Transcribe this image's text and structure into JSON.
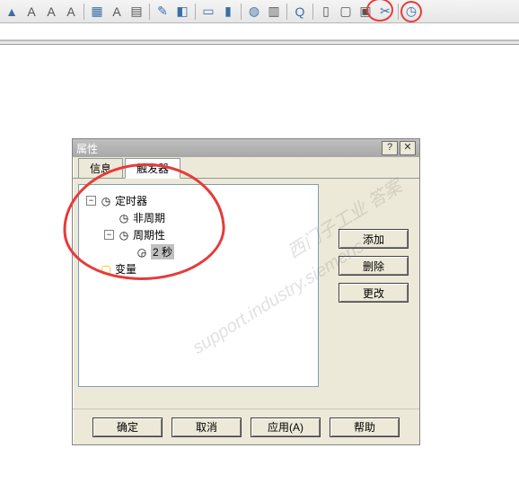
{
  "toolbar": {
    "buttons": [
      {
        "name": "pointer-icon",
        "glyph": "▲",
        "cls": "blue"
      },
      {
        "name": "text-a-icon",
        "glyph": "A"
      },
      {
        "name": "a-slash-icon",
        "glyph": "A"
      },
      {
        "name": "a-italic-icon",
        "glyph": "A"
      },
      {
        "sep": true
      },
      {
        "name": "palette-icon",
        "glyph": "▦",
        "cls": "blue"
      },
      {
        "name": "font-color-icon",
        "glyph": "A"
      },
      {
        "name": "brush-icon",
        "glyph": "▤"
      },
      {
        "sep": true
      },
      {
        "name": "wrench-icon",
        "glyph": "✎",
        "cls": "blue"
      },
      {
        "name": "window-icon",
        "glyph": "◧",
        "cls": "blue"
      },
      {
        "sep": true
      },
      {
        "name": "panel-icon",
        "glyph": "▭",
        "cls": "blue"
      },
      {
        "name": "fill-icon",
        "glyph": "▮",
        "cls": "blue"
      },
      {
        "sep": true
      },
      {
        "name": "globe-icon",
        "glyph": "◍",
        "cls": "blue"
      },
      {
        "name": "chart-icon",
        "glyph": "▥"
      },
      {
        "sep": true
      },
      {
        "name": "search-icon",
        "glyph": "Q",
        "cls": "blue"
      },
      {
        "sep": true
      },
      {
        "name": "folder-icon",
        "glyph": "▯"
      },
      {
        "name": "archive-icon",
        "glyph": "▢"
      },
      {
        "name": "package-icon",
        "glyph": "▣"
      },
      {
        "name": "scissors-icon",
        "glyph": "✂",
        "cls": "blue"
      },
      {
        "sep": true
      },
      {
        "name": "clock-icon",
        "glyph": "◷",
        "cls": "blue",
        "circled": true
      }
    ]
  },
  "dialog": {
    "title": "属性",
    "help_label": "?",
    "close_label": "✕",
    "tabs": [
      {
        "id": "info",
        "label": "信息"
      },
      {
        "id": "trigger",
        "label": "触发器",
        "active": true
      }
    ],
    "tree": {
      "timer": {
        "label": "定时器",
        "icon": "◷"
      },
      "aperiodic": {
        "label": "非周期",
        "icon": "◷"
      },
      "periodic": {
        "label": "周期性",
        "icon": "◷"
      },
      "interval": {
        "label": "2 秒",
        "icon": "◶"
      },
      "variable": {
        "label": "变量",
        "icon": "▢",
        "icon_color": "#f0c000"
      }
    },
    "side": {
      "add": "添加",
      "delete": "删除",
      "modify": "更改"
    },
    "bottom": {
      "ok": "确定",
      "cancel": "取消",
      "apply": "应用(A)",
      "help": "帮助"
    }
  },
  "watermark": {
    "line1": "西门子工业 答案",
    "line2": "support.industry.siemens"
  }
}
